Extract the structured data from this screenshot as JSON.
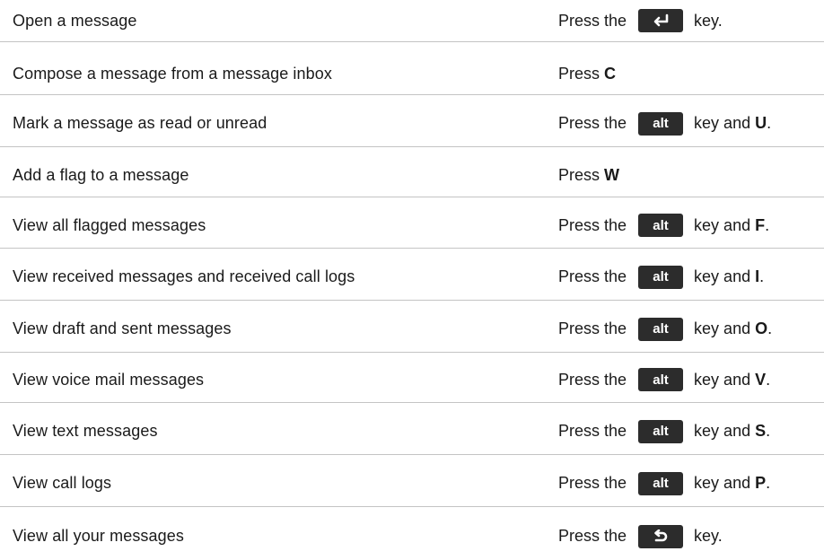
{
  "rows": [
    {
      "action": "Open a message",
      "prefix": "Press the",
      "key": "enter-icon",
      "key_label": "",
      "suffix": "key.",
      "letter": "",
      "end": ""
    },
    {
      "action": "Compose a message from a message inbox",
      "prefix": "Press",
      "key": "",
      "key_label": "",
      "suffix": "",
      "letter": "C",
      "end": ""
    },
    {
      "action": "Mark a message as read or unread",
      "prefix": "Press the",
      "key": "alt",
      "key_label": "alt",
      "suffix": "key and",
      "letter": "U",
      "end": "."
    },
    {
      "action": "Add a flag to a message",
      "prefix": "Press",
      "key": "",
      "key_label": "",
      "suffix": "",
      "letter": "W",
      "end": ""
    },
    {
      "action": "View all flagged messages",
      "prefix": "Press the",
      "key": "alt",
      "key_label": "alt",
      "suffix": "key and",
      "letter": "F",
      "end": "."
    },
    {
      "action": "View received messages and received call logs",
      "prefix": "Press the",
      "key": "alt",
      "key_label": "alt",
      "suffix": "key and",
      "letter": "I",
      "end": "."
    },
    {
      "action": "View draft and sent messages",
      "prefix": "Press the",
      "key": "alt",
      "key_label": "alt",
      "suffix": "key and",
      "letter": "O",
      "end": "."
    },
    {
      "action": "View voice mail messages",
      "prefix": "Press the",
      "key": "alt",
      "key_label": "alt",
      "suffix": "key and",
      "letter": "V",
      "end": "."
    },
    {
      "action": "View text messages",
      "prefix": "Press the",
      "key": "alt",
      "key_label": "alt",
      "suffix": "key and",
      "letter": "S",
      "end": "."
    },
    {
      "action": "View call logs",
      "prefix": "Press the",
      "key": "alt",
      "key_label": "alt",
      "suffix": "key and",
      "letter": "P",
      "end": "."
    },
    {
      "action": "View all your messages",
      "prefix": "Press the",
      "key": "escape-icon",
      "key_label": "",
      "suffix": "key.",
      "letter": "",
      "end": ""
    }
  ],
  "colors": {
    "key_bg": "#2c2c2c",
    "key_fg": "#ffffff",
    "divider": "#c4c4c4"
  }
}
